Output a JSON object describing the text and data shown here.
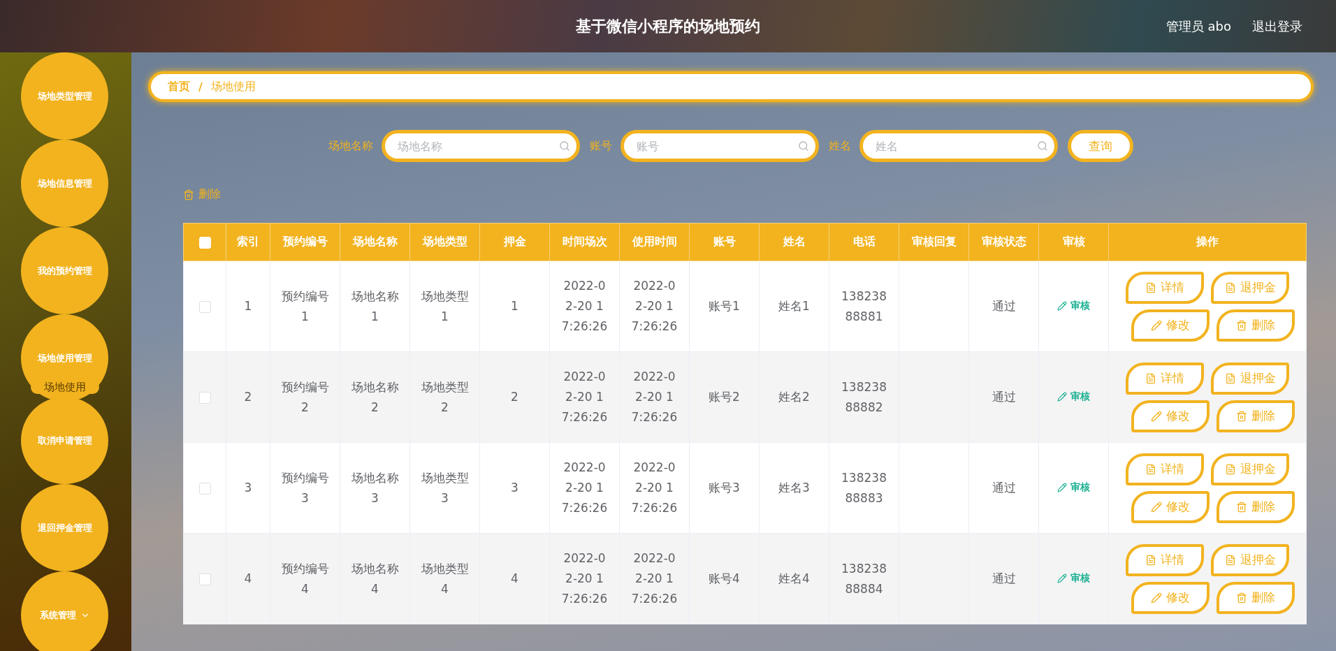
{
  "header": {
    "title": "基于微信小程序的场地预约",
    "user": "管理员 abo",
    "logout": "退出登录"
  },
  "sidebar": {
    "items": [
      {
        "label": "场地类型管理",
        "collapsible": false
      },
      {
        "label": "场地信息管理",
        "collapsible": false
      },
      {
        "label": "我的预约管理",
        "collapsible": false
      },
      {
        "label": "场地使用管理",
        "collapsible": false,
        "children": [
          {
            "label": "场地使用",
            "selected": true
          }
        ]
      },
      {
        "label": "取消申请管理",
        "collapsible": false
      },
      {
        "label": "退回押金管理",
        "collapsible": false
      },
      {
        "label": "系统管理",
        "collapsible": true
      }
    ]
  },
  "breadcrumb": {
    "items": [
      "首页",
      "场地使用"
    ],
    "separator": "/"
  },
  "search": {
    "fields": [
      {
        "label": "场地名称",
        "placeholder": "场地名称"
      },
      {
        "label": "账号",
        "placeholder": "账号"
      },
      {
        "label": "姓名",
        "placeholder": "姓名"
      }
    ],
    "button": "查询"
  },
  "toolbar": {
    "delete": "删除"
  },
  "table": {
    "select_all": {
      "checked": false
    },
    "columns": [
      "索引",
      "预约编号",
      "场地名称",
      "场地类型",
      "押金",
      "时间场次",
      "使用时间",
      "账号",
      "姓名",
      "电话",
      "审核回复",
      "审核状态",
      "审核",
      "操作"
    ],
    "rows": [
      {
        "checked": false,
        "cells": [
          "1",
          "预约编号1",
          "场地名称1",
          "场地类型1",
          "1",
          "2022-02-20 17:26:26",
          "2022-02-20 17:26:26",
          "账号1",
          "姓名1",
          "13823888881",
          "",
          "通过"
        ],
        "review": "审核",
        "actions": [
          {
            "kind": "detail",
            "label": "详情"
          },
          {
            "kind": "refund",
            "label": "退押金"
          },
          {
            "kind": "edit",
            "label": "修改"
          },
          {
            "kind": "delete",
            "label": "删除"
          }
        ]
      },
      {
        "checked": false,
        "cells": [
          "2",
          "预约编号2",
          "场地名称2",
          "场地类型2",
          "2",
          "2022-02-20 17:26:26",
          "2022-02-20 17:26:26",
          "账号2",
          "姓名2",
          "13823888882",
          "",
          "通过"
        ],
        "review": "审核",
        "actions": [
          {
            "kind": "detail",
            "label": "详情"
          },
          {
            "kind": "refund",
            "label": "退押金"
          },
          {
            "kind": "edit",
            "label": "修改"
          },
          {
            "kind": "delete",
            "label": "删除"
          }
        ]
      },
      {
        "checked": false,
        "cells": [
          "3",
          "预约编号3",
          "场地名称3",
          "场地类型3",
          "3",
          "2022-02-20 17:26:26",
          "2022-02-20 17:26:26",
          "账号3",
          "姓名3",
          "13823888883",
          "",
          "通过"
        ],
        "review": "审核",
        "actions": [
          {
            "kind": "detail",
            "label": "详情"
          },
          {
            "kind": "refund",
            "label": "退押金"
          },
          {
            "kind": "edit",
            "label": "修改"
          },
          {
            "kind": "delete",
            "label": "删除"
          }
        ]
      },
      {
        "checked": false,
        "cells": [
          "4",
          "预约编号4",
          "场地名称4",
          "场地类型4",
          "4",
          "2022-02-20 17:26:26",
          "2022-02-20 17:26:26",
          "账号4",
          "姓名4",
          "13823888884",
          "",
          "通过"
        ],
        "review": "审核",
        "actions": [
          {
            "kind": "detail",
            "label": "详情"
          },
          {
            "kind": "refund",
            "label": "退押金"
          },
          {
            "kind": "edit",
            "label": "修改"
          },
          {
            "kind": "delete",
            "label": "删除"
          }
        ]
      }
    ]
  }
}
